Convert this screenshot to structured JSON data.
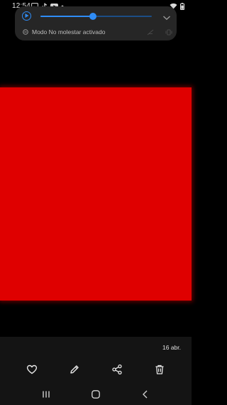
{
  "status_bar": {
    "time": "12:54",
    "left_icons": [
      "image-notification-icon",
      "tiktok-icon",
      "youtube-icon",
      "dot-icon"
    ],
    "right_icons": [
      "wifi-icon",
      "battery-icon"
    ]
  },
  "quick_panel": {
    "volume_level": 0.47,
    "dnd_text": "Modo No molestar activado",
    "accent_color": "#2f8cf6"
  },
  "photo": {
    "fill_color": "#df0000"
  },
  "bottom_bar": {
    "date": "16 abr.",
    "actions": [
      "favorite",
      "edit",
      "share",
      "delete"
    ]
  },
  "nav_bar": {
    "buttons": [
      "recent-apps",
      "home",
      "back"
    ]
  }
}
